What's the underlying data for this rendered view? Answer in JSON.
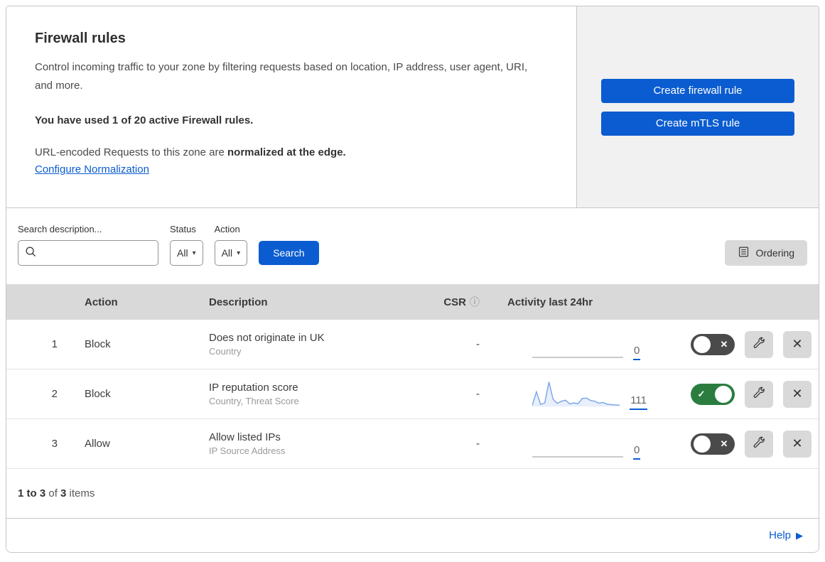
{
  "header": {
    "title": "Firewall rules",
    "description": "Control incoming traffic to your zone by filtering requests based on location, IP address, user agent, URI, and more.",
    "usage_bold": "You have used 1 of 20 active Firewall rules.",
    "normalization_text": "URL-encoded Requests to this zone are ",
    "normalization_bold": "normalized at the edge.",
    "normalization_link": "Configure Normalization",
    "actions": {
      "create_firewall_rule": "Create firewall rule",
      "create_mtls_rule": "Create mTLS rule"
    }
  },
  "filters": {
    "search_label": "Search description...",
    "search_value": "",
    "status_label": "Status",
    "status_value": "All",
    "action_label": "Action",
    "action_value": "All",
    "search_button": "Search",
    "ordering_button": "Ordering"
  },
  "table": {
    "columns": {
      "action": "Action",
      "description": "Description",
      "csr": "CSR",
      "activity": "Activity last 24hr"
    },
    "rows": [
      {
        "priority": "1",
        "action": "Block",
        "description": "Does not originate in UK",
        "criteria": "Country",
        "csr": "-",
        "activity_count": "0",
        "enabled": false,
        "activity_spark": []
      },
      {
        "priority": "2",
        "action": "Block",
        "description": "IP reputation score",
        "criteria": "Country, Threat Score",
        "csr": "-",
        "activity_count": "111",
        "enabled": true,
        "activity_spark": [
          5,
          60,
          9,
          15,
          100,
          30,
          13,
          22,
          26,
          11,
          15,
          12,
          33,
          35,
          25,
          22,
          14,
          17,
          10,
          8,
          7,
          6
        ]
      },
      {
        "priority": "3",
        "action": "Allow",
        "description": "Allow listed IPs",
        "criteria": "IP Source Address",
        "csr": "-",
        "activity_count": "0",
        "enabled": false,
        "activity_spark": []
      }
    ],
    "footer": {
      "range_bold": "1 to 3",
      "of": " of ",
      "total_bold": "3",
      "items": " items"
    }
  },
  "help": {
    "label": "Help"
  },
  "icons": {
    "close": "✕",
    "check": "✓",
    "info": "ⓘ",
    "caret": "▾",
    "help_arrow": "▶"
  },
  "colors": {
    "accent": "#0b5cd0",
    "toggle_on": "#2a7d3f",
    "toggle_off": "#4a4a4a",
    "spark_line": "#7aa7e8",
    "spark_fill": "#e9effb",
    "flat_line": "#b9b9b9"
  }
}
